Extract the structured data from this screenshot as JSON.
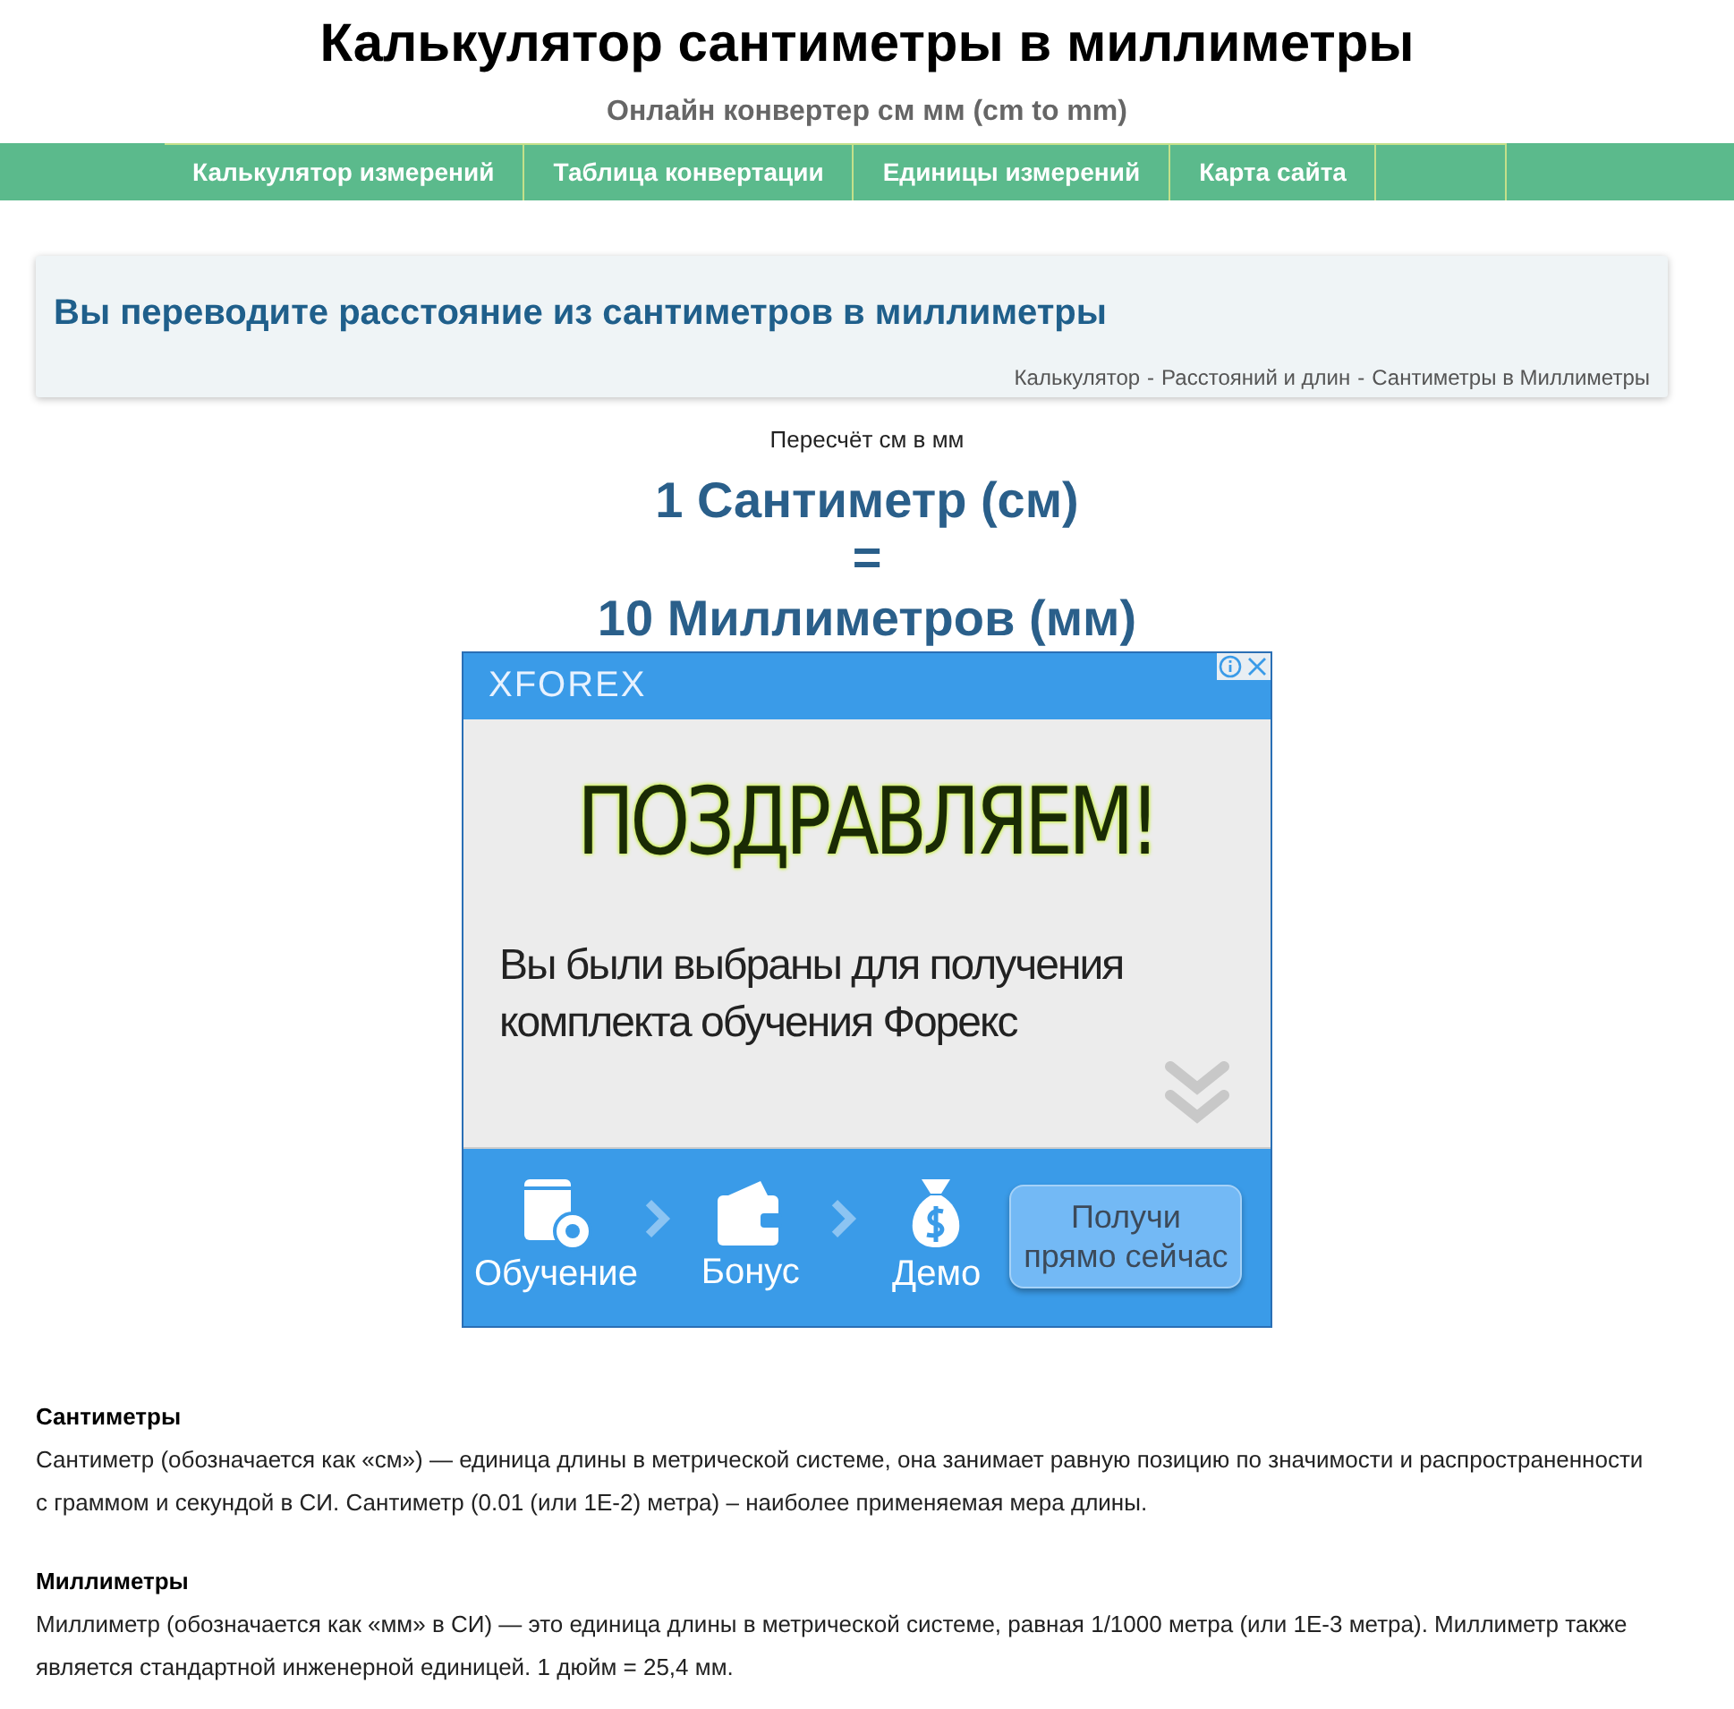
{
  "header": {
    "title": "Калькулятор сантиметры в миллиметры",
    "subtitle": "Онлайн конвертер см мм (cm to mm)"
  },
  "nav": {
    "items": [
      {
        "label": "Калькулятор измерений"
      },
      {
        "label": "Таблица конвертации"
      },
      {
        "label": "Единицы измерений"
      },
      {
        "label": "Карта сайта"
      }
    ]
  },
  "intro": {
    "heading": "Вы переводите расстояние из сантиметров в миллиметры",
    "breadcrumb": [
      "Калькулятор",
      "Расстояний и длин",
      "Сантиметры в Миллиметры"
    ],
    "separator": "-"
  },
  "result": {
    "caption": "Пересчёт см в мм",
    "from": "1 Сантиметр (см)",
    "equals": "=",
    "to": "10 Миллиметров (мм)"
  },
  "ad": {
    "brand": "XFOREX",
    "headline": "ПОЗДРАВЛЯЕМ!",
    "text_lines": [
      "Вы были выбраны для получения",
      "комплекта обучения Форекс"
    ],
    "steps": [
      {
        "kind": "book",
        "label": "Обучение"
      },
      {
        "kind": "wallet",
        "label": "Бонус"
      },
      {
        "kind": "moneybag",
        "label": "Демо"
      }
    ],
    "cta_lines": [
      "Получи",
      "прямо сейчас"
    ]
  },
  "sections": [
    {
      "title": "Сантиметры",
      "text": "Сантиметр (обозначается как «см») — единица длины в метрической системе, она занимает равную позицию по значимости и распространенности с граммом и секундой в СИ. Сантиметр (0.01 (или 1E-2) метра) – наиболее применяемая мера длины."
    },
    {
      "title": "Миллиметры",
      "text": "Миллиметр (обозначается как «мм» в СИ) — это единица длины в метрической системе, равная 1/1000 метра (или 1E-3 метра). Миллиметр также является стандартной инженерной единицей. 1 дюйм = 25,4 мм."
    }
  ]
}
